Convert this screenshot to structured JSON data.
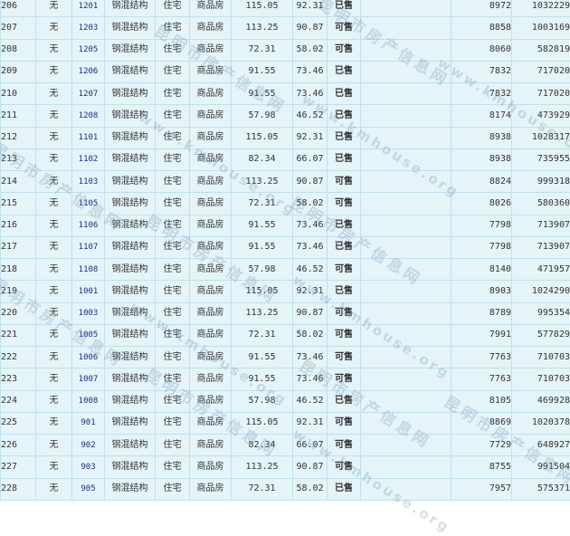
{
  "watermark": {
    "cn_text": "昆明市房产信息网",
    "url_text": "www.kmhouse.org"
  },
  "rows": [
    {
      "idx": "206",
      "mark": "无",
      "room": "1201",
      "structure": "钢混结构",
      "use": "住宅",
      "type": "商品房",
      "area_build": "115.05",
      "area_inner": "92.31",
      "status": "已售",
      "status_kind": "sold",
      "unit_price": "8972",
      "total_price": "1032229"
    },
    {
      "idx": "207",
      "mark": "无",
      "room": "1203",
      "structure": "钢混结构",
      "use": "住宅",
      "type": "商品房",
      "area_build": "113.25",
      "area_inner": "90.87",
      "status": "可售",
      "status_kind": "avail",
      "unit_price": "8858",
      "total_price": "1003169"
    },
    {
      "idx": "208",
      "mark": "无",
      "room": "1205",
      "structure": "钢混结构",
      "use": "住宅",
      "type": "商品房",
      "area_build": "72.31",
      "area_inner": "58.02",
      "status": "可售",
      "status_kind": "avail",
      "unit_price": "8060",
      "total_price": "582819"
    },
    {
      "idx": "209",
      "mark": "无",
      "room": "1206",
      "structure": "钢混结构",
      "use": "住宅",
      "type": "商品房",
      "area_build": "91.55",
      "area_inner": "73.46",
      "status": "已售",
      "status_kind": "sold",
      "unit_price": "7832",
      "total_price": "717020"
    },
    {
      "idx": "210",
      "mark": "无",
      "room": "1207",
      "structure": "钢混结构",
      "use": "住宅",
      "type": "商品房",
      "area_build": "91.55",
      "area_inner": "73.46",
      "status": "已售",
      "status_kind": "sold",
      "unit_price": "7832",
      "total_price": "717020"
    },
    {
      "idx": "211",
      "mark": "无",
      "room": "1208",
      "structure": "钢混结构",
      "use": "住宅",
      "type": "商品房",
      "area_build": "57.98",
      "area_inner": "46.52",
      "status": "已售",
      "status_kind": "sold",
      "unit_price": "8174",
      "total_price": "473929"
    },
    {
      "idx": "212",
      "mark": "无",
      "room": "1101",
      "structure": "钢混结构",
      "use": "住宅",
      "type": "商品房",
      "area_build": "115.05",
      "area_inner": "92.31",
      "status": "已售",
      "status_kind": "sold",
      "unit_price": "8938",
      "total_price": "1028317"
    },
    {
      "idx": "213",
      "mark": "无",
      "room": "1102",
      "structure": "钢混结构",
      "use": "住宅",
      "type": "商品房",
      "area_build": "82.34",
      "area_inner": "66.07",
      "status": "已售",
      "status_kind": "sold",
      "unit_price": "8938",
      "total_price": "735955"
    },
    {
      "idx": "214",
      "mark": "无",
      "room": "1103",
      "structure": "钢混结构",
      "use": "住宅",
      "type": "商品房",
      "area_build": "113.25",
      "area_inner": "90.87",
      "status": "可售",
      "status_kind": "avail",
      "unit_price": "8824",
      "total_price": "999318"
    },
    {
      "idx": "215",
      "mark": "无",
      "room": "1105",
      "structure": "钢混结构",
      "use": "住宅",
      "type": "商品房",
      "area_build": "72.31",
      "area_inner": "58.02",
      "status": "可售",
      "status_kind": "avail",
      "unit_price": "8026",
      "total_price": "580360"
    },
    {
      "idx": "216",
      "mark": "无",
      "room": "1106",
      "structure": "钢混结构",
      "use": "住宅",
      "type": "商品房",
      "area_build": "91.55",
      "area_inner": "73.46",
      "status": "已售",
      "status_kind": "sold",
      "unit_price": "7798",
      "total_price": "713907"
    },
    {
      "idx": "217",
      "mark": "无",
      "room": "1107",
      "structure": "钢混结构",
      "use": "住宅",
      "type": "商品房",
      "area_build": "91.55",
      "area_inner": "73.46",
      "status": "已售",
      "status_kind": "sold",
      "unit_price": "7798",
      "total_price": "713907"
    },
    {
      "idx": "218",
      "mark": "无",
      "room": "1108",
      "structure": "钢混结构",
      "use": "住宅",
      "type": "商品房",
      "area_build": "57.98",
      "area_inner": "46.52",
      "status": "可售",
      "status_kind": "avail",
      "unit_price": "8140",
      "total_price": "471957"
    },
    {
      "idx": "219",
      "mark": "无",
      "room": "1001",
      "structure": "钢混结构",
      "use": "住宅",
      "type": "商品房",
      "area_build": "115.05",
      "area_inner": "92.31",
      "status": "已售",
      "status_kind": "sold",
      "unit_price": "8903",
      "total_price": "1024290"
    },
    {
      "idx": "220",
      "mark": "无",
      "room": "1003",
      "structure": "钢混结构",
      "use": "住宅",
      "type": "商品房",
      "area_build": "113.25",
      "area_inner": "90.87",
      "status": "可售",
      "status_kind": "avail",
      "unit_price": "8789",
      "total_price": "995354"
    },
    {
      "idx": "221",
      "mark": "无",
      "room": "1005",
      "structure": "钢混结构",
      "use": "住宅",
      "type": "商品房",
      "area_build": "72.31",
      "area_inner": "58.02",
      "status": "可售",
      "status_kind": "avail",
      "unit_price": "7991",
      "total_price": "577829"
    },
    {
      "idx": "222",
      "mark": "无",
      "room": "1006",
      "structure": "钢混结构",
      "use": "住宅",
      "type": "商品房",
      "area_build": "91.55",
      "area_inner": "73.46",
      "status": "可售",
      "status_kind": "avail",
      "unit_price": "7763",
      "total_price": "710703"
    },
    {
      "idx": "223",
      "mark": "无",
      "room": "1007",
      "structure": "钢混结构",
      "use": "住宅",
      "type": "商品房",
      "area_build": "91.55",
      "area_inner": "73.46",
      "status": "可售",
      "status_kind": "avail",
      "unit_price": "7763",
      "total_price": "710703"
    },
    {
      "idx": "224",
      "mark": "无",
      "room": "1008",
      "structure": "钢混结构",
      "use": "住宅",
      "type": "商品房",
      "area_build": "57.98",
      "area_inner": "46.52",
      "status": "已售",
      "status_kind": "sold",
      "unit_price": "8105",
      "total_price": "469928"
    },
    {
      "idx": "225",
      "mark": "无",
      "room": "901",
      "structure": "钢混结构",
      "use": "住宅",
      "type": "商品房",
      "area_build": "115.05",
      "area_inner": "92.31",
      "status": "可售",
      "status_kind": "avail",
      "unit_price": "8869",
      "total_price": "1020378"
    },
    {
      "idx": "226",
      "mark": "无",
      "room": "902",
      "structure": "钢混结构",
      "use": "住宅",
      "type": "商品房",
      "area_build": "82.34",
      "area_inner": "66.07",
      "status": "可售",
      "status_kind": "avail",
      "unit_price": "7729",
      "total_price": "648927"
    },
    {
      "idx": "227",
      "mark": "无",
      "room": "903",
      "structure": "钢混结构",
      "use": "住宅",
      "type": "商品房",
      "area_build": "113.25",
      "area_inner": "90.87",
      "status": "可售",
      "status_kind": "avail",
      "unit_price": "8755",
      "total_price": "991504"
    },
    {
      "idx": "228",
      "mark": "无",
      "room": "905",
      "structure": "钢混结构",
      "use": "住宅",
      "type": "商品房",
      "area_build": "72.31",
      "area_inner": "58.02",
      "status": "已售",
      "status_kind": "sold",
      "unit_price": "7957",
      "total_price": "575371"
    }
  ]
}
